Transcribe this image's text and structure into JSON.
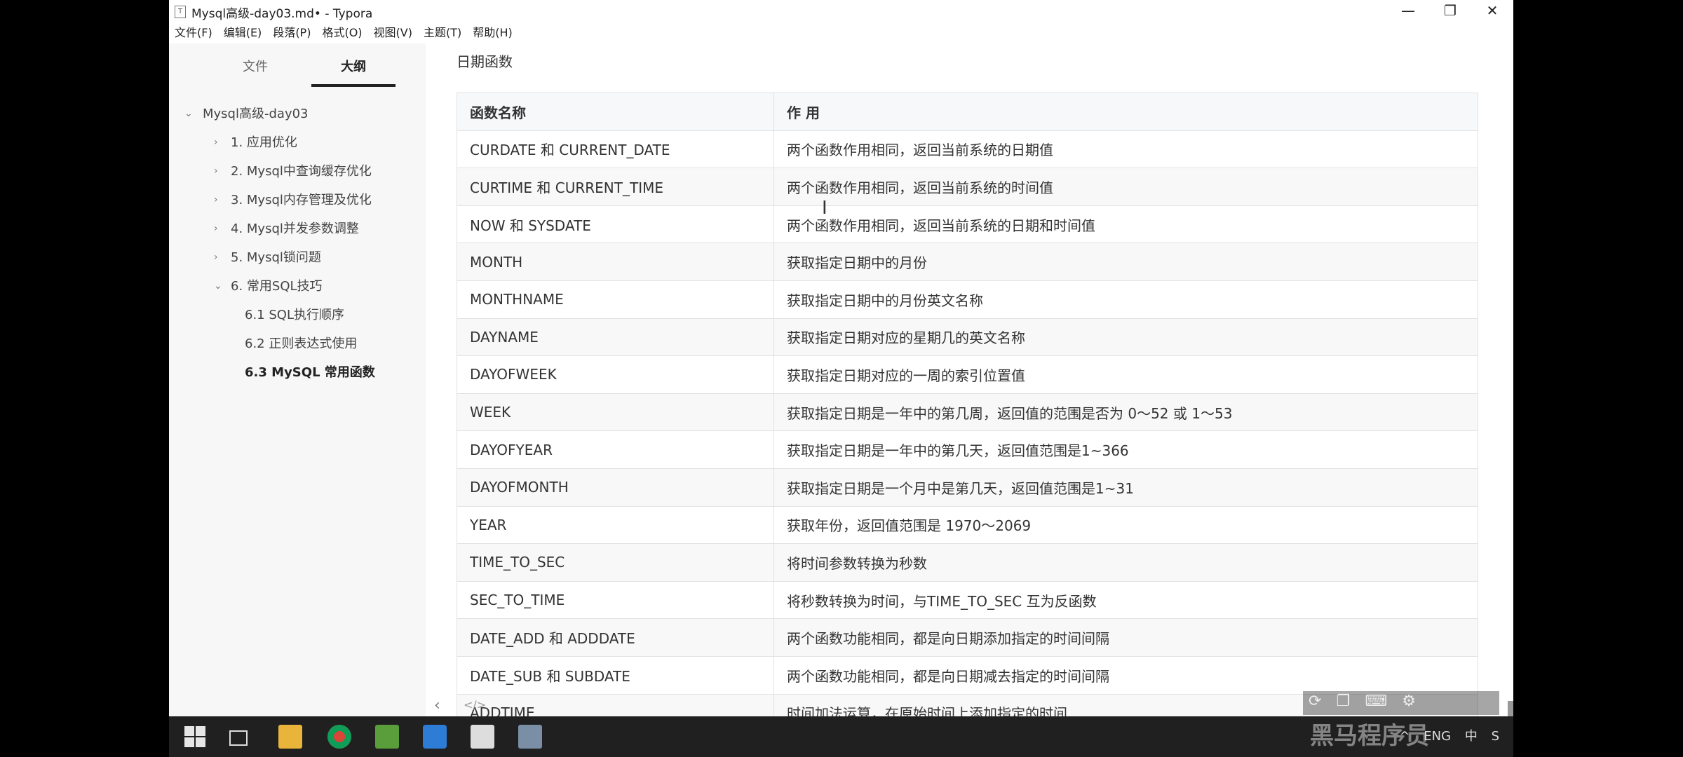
{
  "window": {
    "title": "Mysql高级-day03.md• - Typora",
    "minimize": "—",
    "maximize": "❐",
    "close": "✕"
  },
  "menu": [
    "文件(F)",
    "编辑(E)",
    "段落(P)",
    "格式(O)",
    "视图(V)",
    "主题(T)",
    "帮助(H)"
  ],
  "sidebar": {
    "tabs": [
      "文件",
      "大纲"
    ],
    "active_tab": "大纲",
    "outline": [
      {
        "label": "Mysql高级-day03",
        "level": 0,
        "arrow": "⌄"
      },
      {
        "label": "1. 应用优化",
        "level": 1,
        "arrow": "›"
      },
      {
        "label": "2. Mysql中查询缓存优化",
        "level": 1,
        "arrow": "›"
      },
      {
        "label": "3. Mysql内存管理及优化",
        "level": 1,
        "arrow": "›"
      },
      {
        "label": "4. Mysql并发参数调整",
        "level": 1,
        "arrow": "›"
      },
      {
        "label": "5. Mysql锁问题",
        "level": 1,
        "arrow": "›"
      },
      {
        "label": "6. 常用SQL技巧",
        "level": 1,
        "arrow": "⌄"
      },
      {
        "label": "6.1 SQL执行顺序",
        "level": 2,
        "arrow": ""
      },
      {
        "label": "6.2 正则表达式使用",
        "level": 2,
        "arrow": ""
      },
      {
        "label": "6.3 MySQL 常用函数",
        "level": 2,
        "arrow": "",
        "active": true
      }
    ]
  },
  "editor": {
    "heading": "日期函数",
    "table": {
      "headers": [
        "函数名称",
        "作 用"
      ],
      "rows": [
        [
          "CURDATE 和 CURRENT_DATE",
          "两个函数作用相同，返回当前系统的日期值"
        ],
        [
          "CURTIME 和 CURRENT_TIME",
          "两个函数作用相同，返回当前系统的时间值"
        ],
        [
          "NOW 和  SYSDATE",
          "两个函数作用相同，返回当前系统的日期和时间值"
        ],
        [
          "MONTH",
          "获取指定日期中的月份"
        ],
        [
          "MONTHNAME",
          "获取指定日期中的月份英文名称"
        ],
        [
          "DAYNAME",
          "获取指定日期对应的星期几的英文名称"
        ],
        [
          "DAYOFWEEK",
          "获取指定日期对应的一周的索引位置值"
        ],
        [
          "WEEK",
          "获取指定日期是一年中的第几周，返回值的范围是否为 0〜52 或 1〜53"
        ],
        [
          "DAYOFYEAR",
          "获取指定日期是一年中的第几天，返回值范围是1~366"
        ],
        [
          "DAYOFMONTH",
          "获取指定日期是一个月中是第几天，返回值范围是1~31"
        ],
        [
          "YEAR",
          "获取年份，返回值范围是 1970〜2069"
        ],
        [
          "TIME_TO_SEC",
          "将时间参数转换为秒数"
        ],
        [
          "SEC_TO_TIME",
          "将秒数转换为时间，与TIME_TO_SEC 互为反函数"
        ],
        [
          "DATE_ADD 和 ADDDATE",
          "两个函数功能相同，都是向日期添加指定的时间间隔"
        ],
        [
          "DATE_SUB 和 SUBDATE",
          "两个函数功能相同，都是向日期减去指定的时间间隔"
        ],
        [
          "ADDTIME",
          "时间加法运算，在原始时间上添加指定的时间"
        ]
      ]
    }
  },
  "statusbar": {
    "back": "‹",
    "source_toggle": "</>"
  },
  "overlay": {
    "watermark": "黑马程序员",
    "controls": [
      "⟳",
      "❐",
      "⌨",
      "⚙"
    ]
  },
  "taskbar": {
    "tray": [
      "^",
      "ENG",
      "中",
      "S"
    ]
  },
  "colors": {
    "table_border": "#dfe2e5",
    "header_bg": "#f6f8fa",
    "sidebar_bg": "#f7f7f7",
    "taskbar_bg": "#202020"
  }
}
